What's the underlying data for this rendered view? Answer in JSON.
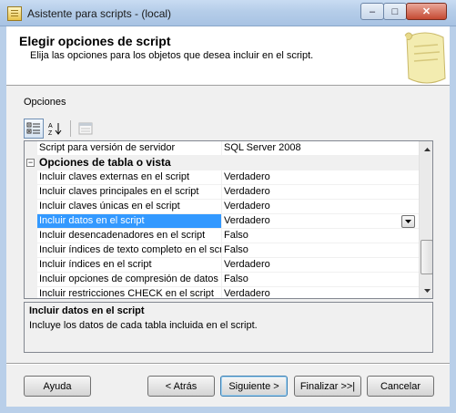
{
  "window": {
    "title": "Asistente para scripts - (local)",
    "minimize_glyph": "–",
    "maximize_glyph": "□",
    "close_glyph": "✕"
  },
  "header": {
    "title": "Elegir opciones de script",
    "subtitle": "Elija las opciones para los objetos que desea incluir en el script."
  },
  "options_label": "Opciones",
  "grid": {
    "rows": [
      {
        "type": "prop",
        "name": "Script para versión de servidor",
        "value": "SQL Server 2008"
      },
      {
        "type": "category",
        "name": "Opciones de tabla o vista",
        "expander": "−"
      },
      {
        "type": "prop",
        "name": "Incluir claves externas en el script",
        "value": "Verdadero"
      },
      {
        "type": "prop",
        "name": "Incluir claves principales en el script",
        "value": "Verdadero"
      },
      {
        "type": "prop",
        "name": "Incluir claves únicas en el script",
        "value": "Verdadero"
      },
      {
        "type": "prop",
        "name": "Incluir datos en el script",
        "value": "Verdadero",
        "selected": true
      },
      {
        "type": "prop",
        "name": "Incluir desencadenadores en el script",
        "value": "Falso"
      },
      {
        "type": "prop",
        "name": "Incluir índices de texto completo en el script",
        "value": "Falso"
      },
      {
        "type": "prop",
        "name": "Incluir índices en el script",
        "value": "Verdadero"
      },
      {
        "type": "prop",
        "name": "Incluir opciones de compresión de datos en el script",
        "value": "Falso"
      },
      {
        "type": "prop",
        "name": "Incluir restricciones CHECK en el script",
        "value": "Verdadero"
      }
    ]
  },
  "description": {
    "title": "Incluir datos en el script",
    "text": "Incluye los datos de cada tabla incluida en el script."
  },
  "buttons": {
    "help": "Ayuda",
    "back": "< Atrás",
    "next": "Siguiente >",
    "finish": "Finalizar >>|",
    "cancel": "Cancelar"
  },
  "colors": {
    "selection": "#3399ff",
    "title_bar": "#b5cde9"
  }
}
